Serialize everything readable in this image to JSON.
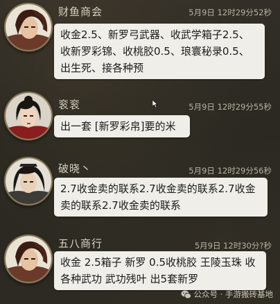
{
  "messages": [
    {
      "sender": "财鱼商会",
      "time": "5月9日 12时29分52秒",
      "lines": [
        "收金2.5、新罗弓武器、收武学箱子2.5、",
        "收新罗彩锦、收桃胶0.5、琅寰秘录0.5、",
        "出生死、接各种预"
      ],
      "avatar_icon": "male-warrior-avatar"
    },
    {
      "sender": "衮衮",
      "time": "5月9日 12时29分55秒",
      "lines": [
        "出一套 [新罗彩帛]要的米"
      ],
      "avatar_icon": "female-avatar"
    },
    {
      "sender": "破晓丶",
      "time": "5月9日 12时29分56秒",
      "lines": [
        "2.7收金卖的联系2.7收金卖的联系2.7收金",
        "卖的联系2.7收金卖的联系"
      ],
      "avatar_icon": "male-longhair-avatar"
    },
    {
      "sender": "五八商行",
      "time": "5月9日 12时30分?秒",
      "lines": [
        "收金 2.5箱子 新罗 0.5收桃胶 王陵玉珠 收",
        "各种武功 武功残叶 出5套新罗"
      ],
      "avatar_icon": "male-warrior-avatar"
    }
  ],
  "footer": {
    "label": "公众号 · 手游搬砖基地",
    "icon": "wechat-icon"
  },
  "colors": {
    "bubble_bg": "#efeee9",
    "name_text": "#d8d3c4",
    "time_text": "#b8b3a5",
    "background": "#2b2a26"
  }
}
